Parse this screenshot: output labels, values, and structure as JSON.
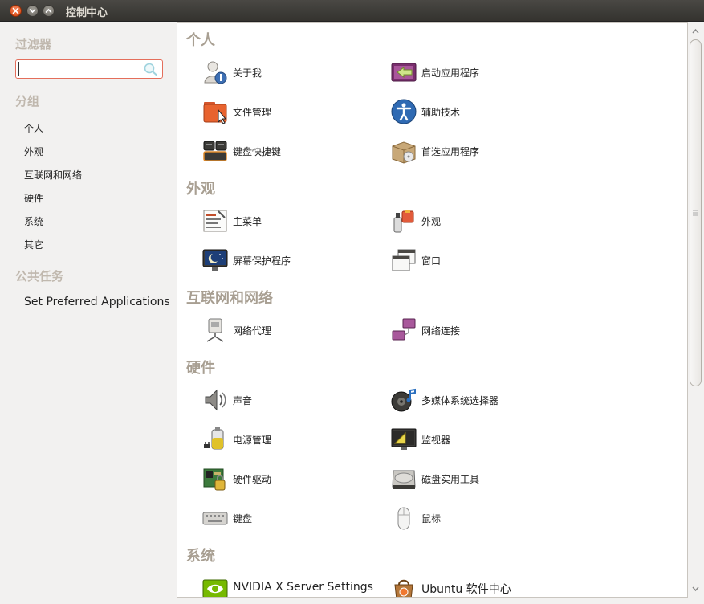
{
  "window": {
    "title": "控制中心"
  },
  "sidebar": {
    "filter_heading": "过滤器",
    "search_value": "",
    "groups_heading": "分组",
    "groups": [
      "个人",
      "外观",
      "互联网和网络",
      "硬件",
      "系统",
      "其它"
    ],
    "tasks_heading": "公共任务",
    "tasks": [
      "Set Preferred Applications"
    ]
  },
  "main": {
    "categories": [
      {
        "title": "个人",
        "items": [
          {
            "label": "关于我",
            "icon": "about-me-icon"
          },
          {
            "label": "启动应用程序",
            "icon": "startup-apps-icon"
          },
          {
            "label": "文件管理",
            "icon": "file-manager-icon"
          },
          {
            "label": "辅助技术",
            "icon": "accessibility-icon"
          },
          {
            "label": "键盘快捷键",
            "icon": "keyboard-shortcuts-icon"
          },
          {
            "label": "首选应用程序",
            "icon": "preferred-apps-icon"
          }
        ]
      },
      {
        "title": "外观",
        "items": [
          {
            "label": "主菜单",
            "icon": "main-menu-icon"
          },
          {
            "label": "外观",
            "icon": "appearance-icon"
          },
          {
            "label": "屏幕保护程序",
            "icon": "screensaver-icon"
          },
          {
            "label": "窗口",
            "icon": "windows-icon"
          }
        ]
      },
      {
        "title": "互联网和网络",
        "items": [
          {
            "label": "网络代理",
            "icon": "network-proxy-icon"
          },
          {
            "label": "网络连接",
            "icon": "network-connections-icon"
          }
        ]
      },
      {
        "title": "硬件",
        "items": [
          {
            "label": "声音",
            "icon": "sound-icon"
          },
          {
            "label": "多媒体系统选择器",
            "icon": "multimedia-selector-icon"
          },
          {
            "label": "电源管理",
            "icon": "power-management-icon"
          },
          {
            "label": "监视器",
            "icon": "monitor-icon"
          },
          {
            "label": "硬件驱动",
            "icon": "hardware-drivers-icon"
          },
          {
            "label": "磁盘实用工具",
            "icon": "disk-utility-icon"
          },
          {
            "label": "键盘",
            "icon": "keyboard-icon"
          },
          {
            "label": "鼠标",
            "icon": "mouse-icon"
          }
        ]
      },
      {
        "title": "系统",
        "items": [
          {
            "label": "NVIDIA X Server Settings",
            "icon": "nvidia-icon"
          },
          {
            "label": "Ubuntu 软件中心",
            "icon": "software-center-icon"
          }
        ]
      }
    ]
  }
}
